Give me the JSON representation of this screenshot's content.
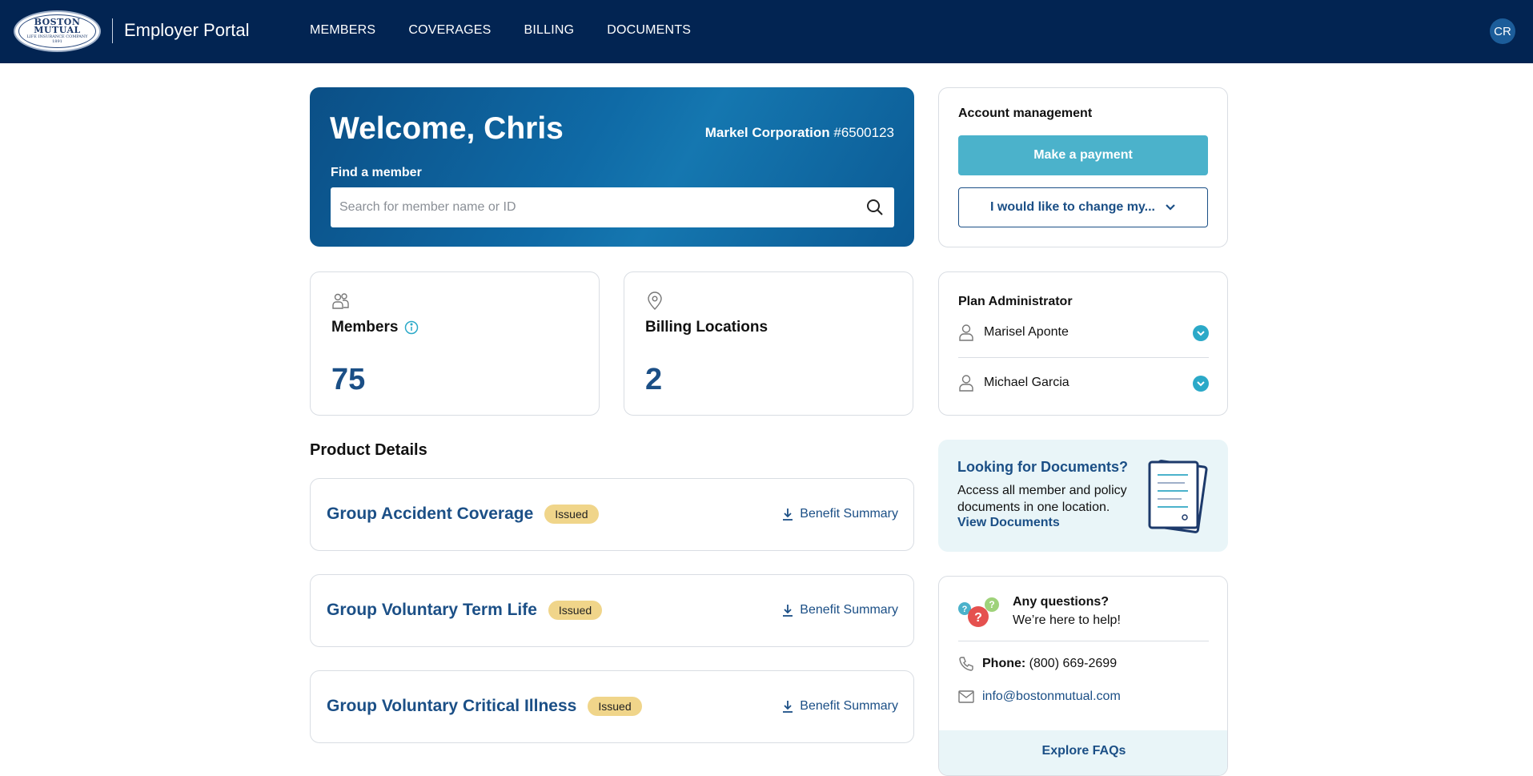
{
  "header": {
    "logo": {
      "line1": "BOSTON",
      "line2": "MUTUAL",
      "line3": "LIFE INSURANCE COMPANY",
      "line4": "1891"
    },
    "portal_title": "Employer Portal",
    "nav": [
      "MEMBERS",
      "COVERAGES",
      "BILLING",
      "DOCUMENTS"
    ],
    "avatar_initials": "CR"
  },
  "welcome": {
    "greeting": "Welcome, Chris",
    "company": "Markel Corporation",
    "company_id": "#6500123",
    "find_label": "Find a member",
    "search_placeholder": "Search for member name or ID"
  },
  "account": {
    "title": "Account management",
    "pay_label": "Make a payment",
    "change_label": "I would like to change my..."
  },
  "stats": {
    "members": {
      "label": "Members",
      "value": "75"
    },
    "billing": {
      "label": "Billing Locations",
      "value": "2"
    }
  },
  "plan_admin": {
    "title": "Plan Administrator",
    "people": [
      "Marisel Aponte",
      "Michael Garcia"
    ]
  },
  "products": {
    "title": "Product Details",
    "items": [
      {
        "name": "Group Accident Coverage",
        "status": "Issued",
        "link": "Benefit Summary"
      },
      {
        "name": "Group Voluntary Term Life",
        "status": "Issued",
        "link": "Benefit Summary"
      },
      {
        "name": "Group Voluntary Critical Illness",
        "status": "Issued",
        "link": "Benefit Summary"
      }
    ]
  },
  "documents": {
    "title": "Looking for Documents?",
    "description": "Access all member and policy documents in one location.",
    "link": "View Documents"
  },
  "help": {
    "line1": "Any questions?",
    "line2": "We’re here to help!",
    "phone_label": "Phone:",
    "phone": "(800) 669-2699",
    "email": "info@bostonmutual.com",
    "faq": "Explore FAQs"
  },
  "colors": {
    "navy": "#022452",
    "brand_blue": "#1b4f86",
    "teal": "#4bb2cb",
    "badge": "#f0d58a"
  }
}
